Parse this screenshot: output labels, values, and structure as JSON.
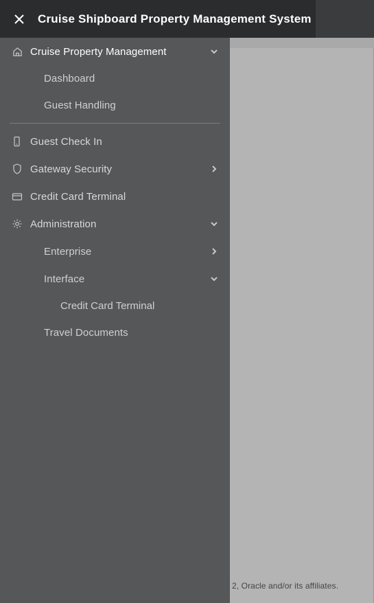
{
  "header": {
    "title": "Cruise Shipboard Property Management System"
  },
  "nav": {
    "cruisePropMgmt": {
      "label": "Cruise Property Management"
    },
    "dashboard": {
      "label": "Dashboard"
    },
    "guestHandling": {
      "label": "Guest Handling"
    },
    "guestCheckIn": {
      "label": "Guest Check In"
    },
    "gatewaySecurity": {
      "label": "Gateway Security"
    },
    "creditCardTerminal": {
      "label": "Credit Card Terminal"
    },
    "administration": {
      "label": "Administration"
    },
    "enterprise": {
      "label": "Enterprise"
    },
    "interface": {
      "label": "Interface"
    },
    "ccTerminalSub": {
      "label": "Credit Card Terminal"
    },
    "travelDocuments": {
      "label": "Travel Documents"
    }
  },
  "footer": {
    "copyright": "2, Oracle and/or its affiliates."
  }
}
